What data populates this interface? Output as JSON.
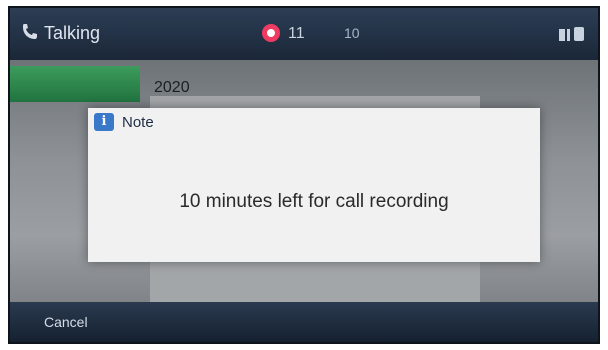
{
  "status_bar": {
    "title": "Talking",
    "timer": "11",
    "time_right": "10"
  },
  "line": {
    "label": "",
    "contact_number": "2020"
  },
  "dialog": {
    "title": "Note",
    "message": "10 minutes left for call recording"
  },
  "softkeys": {
    "cancel_label": "Cancel"
  },
  "colors": {
    "record": "#ef3b62",
    "line_active": "#2f8a4f",
    "info_icon": "#3a78c9"
  }
}
